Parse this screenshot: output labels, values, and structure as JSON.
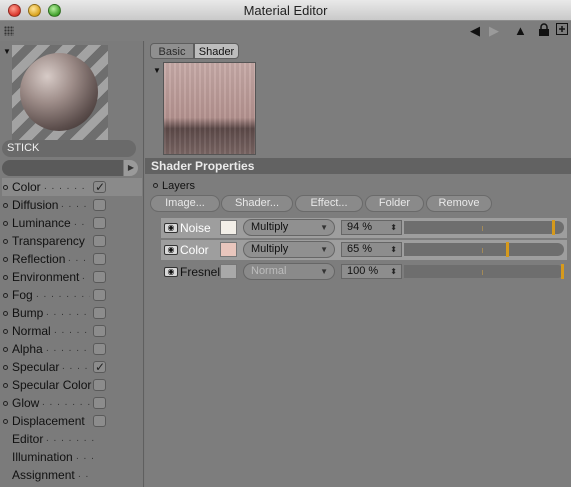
{
  "window": {
    "title": "Material Editor"
  },
  "toolbar": {
    "icons": [
      "grip-icon",
      "back-arrow-icon",
      "forward-arrow-icon",
      "up-arrow-icon",
      "lock-icon",
      "new-window-icon"
    ]
  },
  "material": {
    "name": "STICK"
  },
  "channels": [
    {
      "label": "Color",
      "checked": true,
      "selected": true,
      "has_dot": true,
      "has_box": true
    },
    {
      "label": "Diffusion",
      "checked": false,
      "has_dot": true,
      "has_box": true
    },
    {
      "label": "Luminance",
      "checked": false,
      "has_dot": true,
      "has_box": true
    },
    {
      "label": "Transparency",
      "checked": false,
      "has_dot": true,
      "has_box": true
    },
    {
      "label": "Reflection",
      "checked": false,
      "has_dot": true,
      "has_box": true
    },
    {
      "label": "Environment",
      "checked": false,
      "has_dot": true,
      "has_box": true
    },
    {
      "label": "Fog",
      "checked": false,
      "has_dot": true,
      "has_box": true
    },
    {
      "label": "Bump",
      "checked": false,
      "has_dot": true,
      "has_box": true
    },
    {
      "label": "Normal",
      "checked": false,
      "has_dot": true,
      "has_box": true
    },
    {
      "label": "Alpha",
      "checked": false,
      "has_dot": true,
      "has_box": true
    },
    {
      "label": "Specular",
      "checked": true,
      "has_dot": true,
      "has_box": true
    },
    {
      "label": "Specular Color",
      "checked": false,
      "has_dot": true,
      "has_box": true
    },
    {
      "label": "Glow",
      "checked": false,
      "has_dot": true,
      "has_box": true
    },
    {
      "label": "Displacement",
      "checked": false,
      "has_dot": true,
      "has_box": true
    },
    {
      "label": "Editor",
      "has_dot": false,
      "has_box": false
    },
    {
      "label": "Illumination",
      "has_dot": false,
      "has_box": false
    },
    {
      "label": "Assignment",
      "has_dot": false,
      "has_box": false
    }
  ],
  "tabs": {
    "basic": "Basic",
    "shader": "Shader"
  },
  "shader_properties": {
    "heading": "Shader Properties",
    "layers_label": "Layers",
    "buttons": {
      "image": "Image...",
      "shader": "Shader...",
      "effect": "Effect...",
      "folder": "Folder",
      "remove": "Remove"
    },
    "layers": [
      {
        "name": "Noise",
        "blend": "Multiply",
        "opacity": "94 %",
        "opacity_value": 0.94,
        "highlighted": true,
        "thumb_color": "#f3efe8",
        "enabled": true
      },
      {
        "name": "Color",
        "blend": "Multiply",
        "opacity": "65 %",
        "opacity_value": 0.65,
        "highlighted": true,
        "thumb_color": "#e9c6bd",
        "enabled": true
      },
      {
        "name": "Fresnel",
        "blend": "Normal",
        "opacity": "100 %",
        "opacity_value": 1.0,
        "highlighted": false,
        "thumb_color": "#a9a9a9",
        "enabled": false
      }
    ]
  },
  "colors": {
    "slider_thumb": "#d69a1c",
    "section_header": "#626262"
  }
}
